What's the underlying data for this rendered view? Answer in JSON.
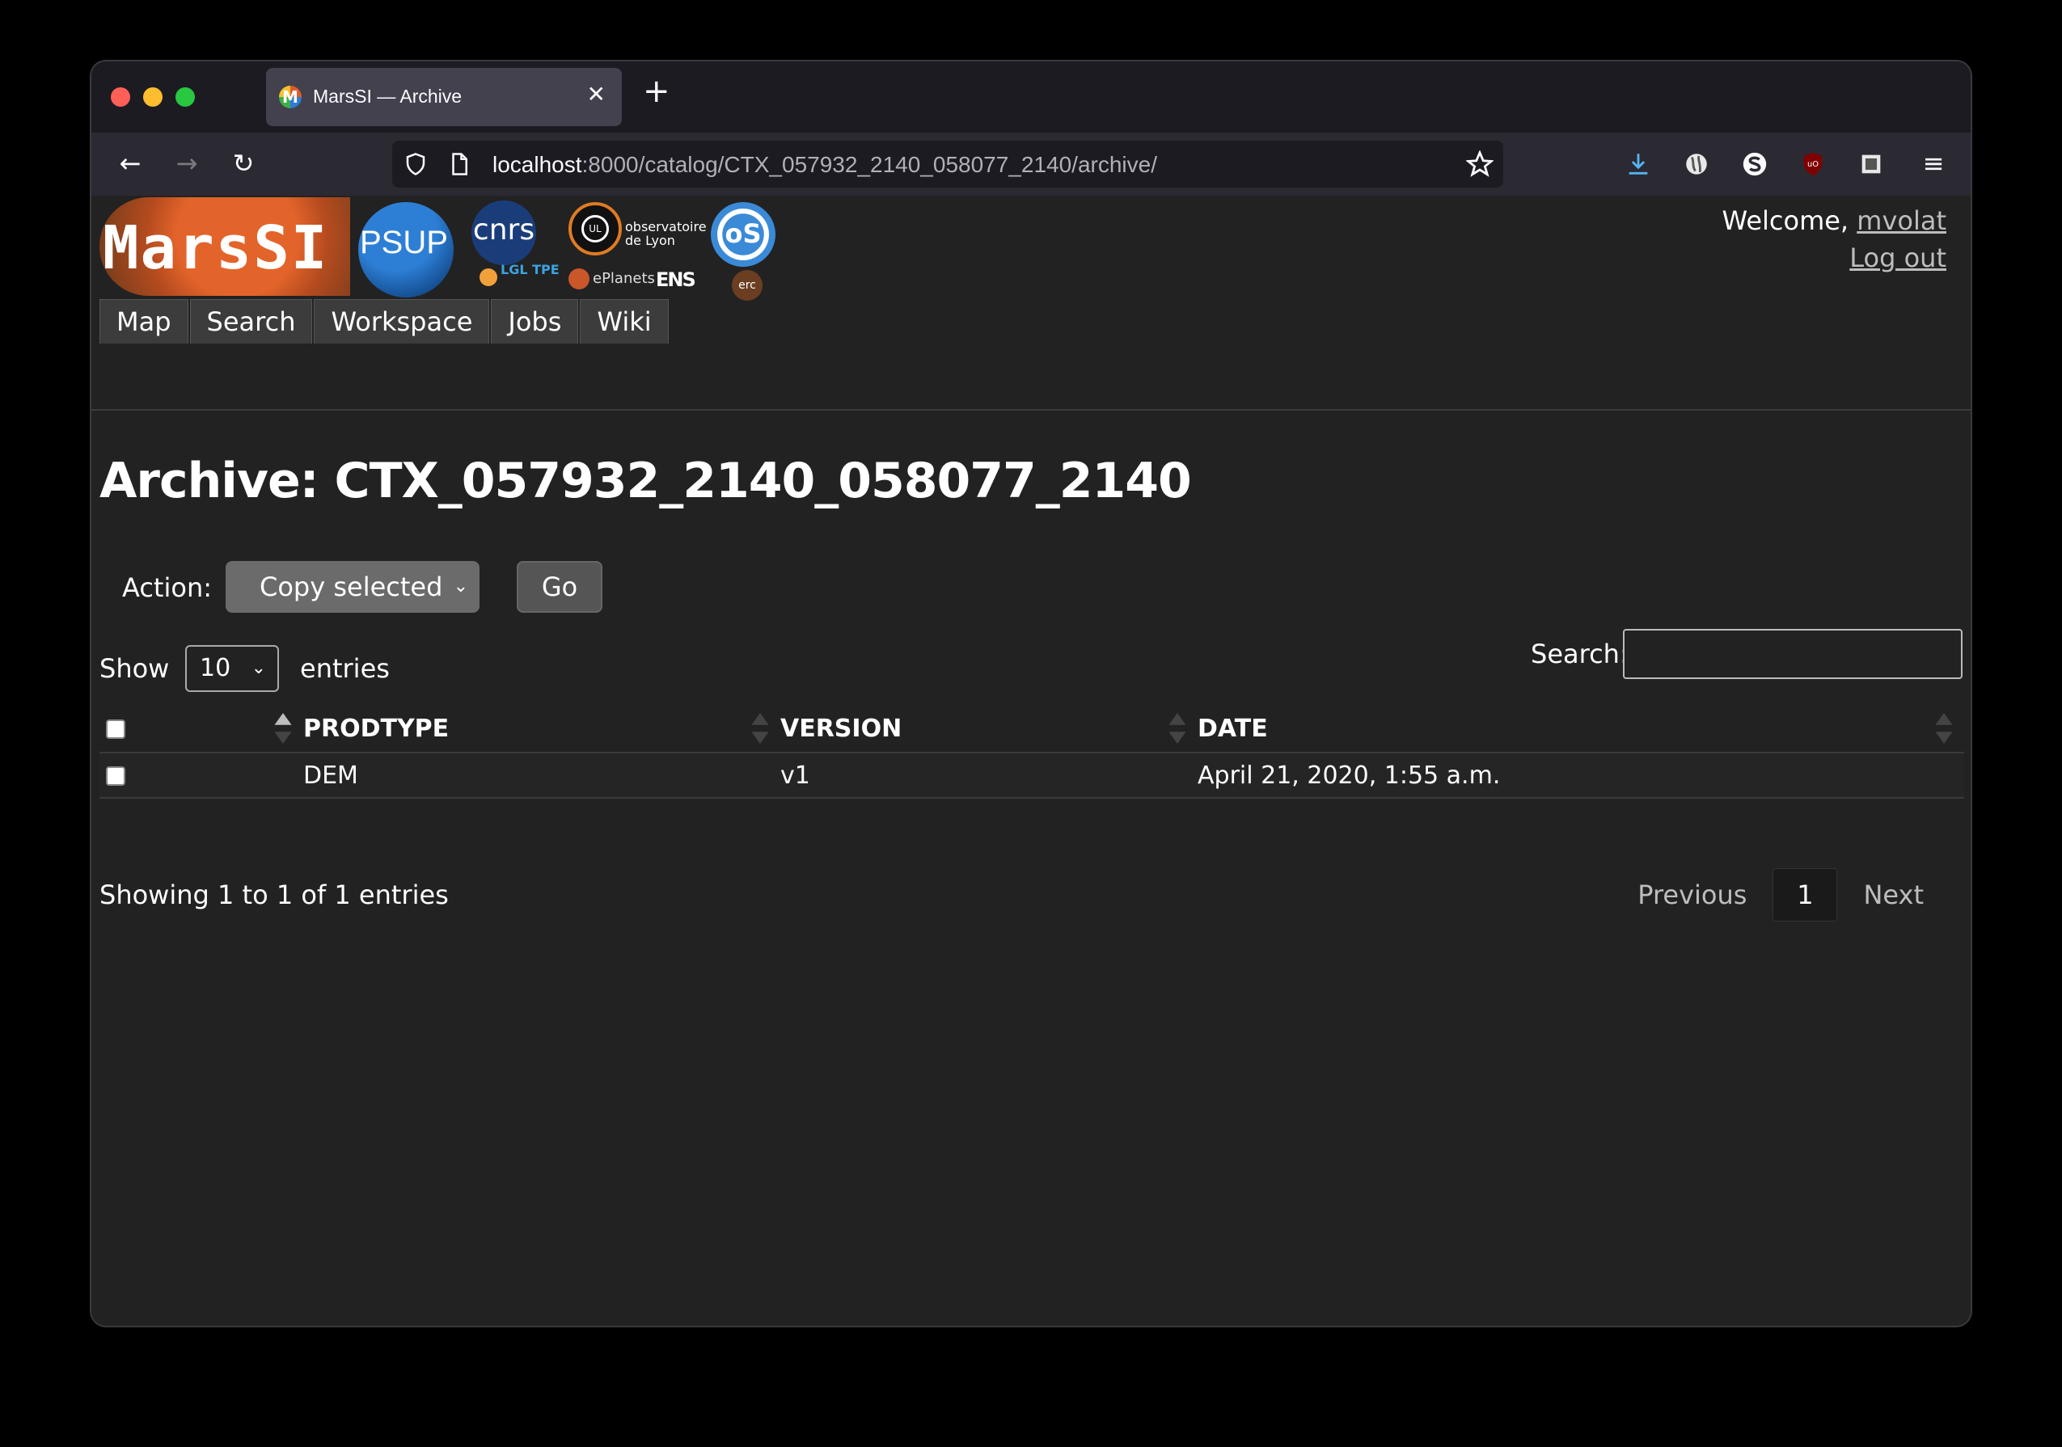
{
  "browser": {
    "tab_title": "MarsSI — Archive",
    "tab_favicon_letter": "M",
    "url_host": "localhost",
    "url_rest": ":8000/catalog/CTX_057932_2140_058077_2140/archive/"
  },
  "header": {
    "logo_text": "MarsSI",
    "psup_text": "PSUP",
    "cnrs_text": "cnrs",
    "lgl_text": "LGL TPE",
    "obs_text": "observatoire de Lyon",
    "obs_badge": "UL",
    "eplanets_text": "ePlanets",
    "ens_text": "ENS",
    "osu_text": "oS",
    "erc_text": "erc",
    "welcome_prefix": "Welcome,",
    "username": "mvolat",
    "logout": "Log out",
    "nav": [
      "Map",
      "Search",
      "Workspace",
      "Jobs",
      "Wiki"
    ]
  },
  "main": {
    "title": "Archive: CTX_057932_2140_058077_2140",
    "action_label": "Action:",
    "action_selected": "Copy selected",
    "go_label": "Go",
    "show_label": "Show",
    "page_length": "10",
    "entries_label": "entries",
    "search_label": "Search:",
    "search_value": "",
    "columns": [
      "PRODTYPE",
      "VERSION",
      "DATE"
    ],
    "rows": [
      {
        "prodtype": "DEM",
        "version": "v1",
        "date": "April 21, 2020, 1:55 a.m."
      }
    ],
    "info": "Showing 1 to 1 of 1 entries",
    "prev": "Previous",
    "current_page": "1",
    "next": "Next"
  },
  "colors": {
    "page_bg": "#222222",
    "tabstrip_bg": "#1c1b22",
    "toolbar_bg": "#2b2a33",
    "link": "#bdbdbd"
  }
}
